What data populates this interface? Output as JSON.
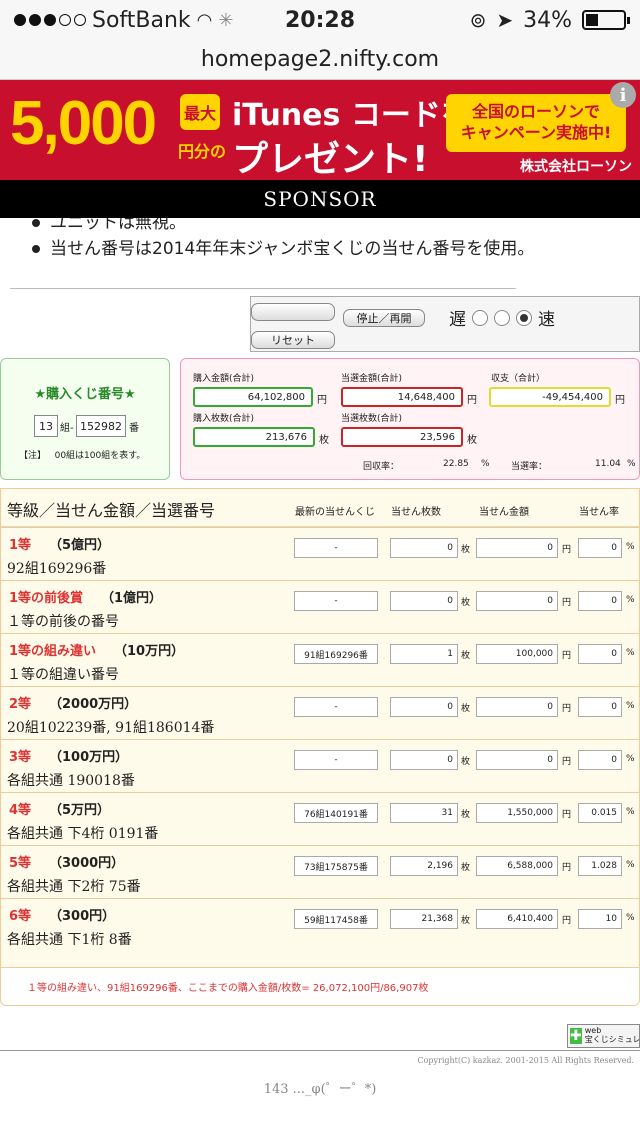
{
  "status": {
    "carrier": "SoftBank",
    "time": "20:28",
    "battery": "34%",
    "battery_level": 0.34
  },
  "url": "homepage2.nifty.com",
  "banner": {
    "amount": "5,000",
    "max": "最大",
    "yen": "円分の",
    "itunes": "iTunes コードを",
    "present": "プレゼント!",
    "box_line1": "全国のローソンで",
    "box_line2": "キャンペーン実施中!",
    "company": "株式会社ローソン",
    "info": "i"
  },
  "sponsor": "SPONSOR",
  "notes": [
    "ユニットは無視。",
    "当せん番号は2014年年末ジャンボ宝くじの当せん番号を使用。"
  ],
  "controls": {
    "stop": "停止／再開",
    "reset": "リセット",
    "slow": "遅",
    "fast": "速"
  },
  "ticket": {
    "title": "★購入くじ番号★",
    "group": "13",
    "group_unit": "組-",
    "number": "152982",
    "number_unit": "番",
    "note_label": "【注】",
    "note": "00組は100組を表す。"
  },
  "stats": {
    "purchase_amount_label": "購入金額(合計)",
    "purchase_amount": "64,102,800",
    "yen": "円",
    "win_amount_label": "当選金額(合計)",
    "win_amount": "14,648,400",
    "balance_label": "収支（合計）",
    "balance": "-49,454,400",
    "purchase_count_label": "購入枚数(合計)",
    "purchase_count": "213,676",
    "mai": "枚",
    "win_count_label": "当選枚数(合計)",
    "win_count": "23,596",
    "return_label": "回収率：",
    "return_rate": "22.85",
    "win_rate_label": "当選率：",
    "win_rate": "11.04",
    "pct": "%"
  },
  "results": {
    "headers": [
      "等級／当せん金額／当選番号",
      "最新の当せんくじ",
      "当せん枚数",
      "当せん金額",
      "当せん率"
    ],
    "units": {
      "mai": "枚",
      "yen": "円",
      "pct": "%"
    },
    "rows": [
      {
        "name": "1等",
        "amount": "（5億円）",
        "number": "92組169296番",
        "latest": "-",
        "count": "0",
        "money": "0",
        "rate": "0"
      },
      {
        "name": "1等の前後賞",
        "amount": "（1億円）",
        "number": "１等の前後の番号",
        "latest": "-",
        "count": "0",
        "money": "0",
        "rate": "0"
      },
      {
        "name": "1等の組み違い",
        "amount": "（10万円）",
        "number": "１等の組違い番号",
        "latest": "91組169296番",
        "count": "1",
        "money": "100,000",
        "rate": "0"
      },
      {
        "name": "2等",
        "amount": "（2000万円）",
        "number": "20組102239番, 91組186014番",
        "latest": "-",
        "count": "0",
        "money": "0",
        "rate": "0"
      },
      {
        "name": "3等",
        "amount": "（100万円）",
        "number": "各組共通 190018番",
        "latest": "-",
        "count": "0",
        "money": "0",
        "rate": "0"
      },
      {
        "name": "4等",
        "amount": "（5万円）",
        "number": "各組共通 下4桁 0191番",
        "latest": "76組140191番",
        "count": "31",
        "money": "1,550,000",
        "rate": "0.015"
      },
      {
        "name": "5等",
        "amount": "（3000円）",
        "number": "各組共通 下2桁 75番",
        "latest": "73組175875番",
        "count": "2,196",
        "money": "6,588,000",
        "rate": "1.028"
      },
      {
        "name": "6等",
        "amount": "（300円）",
        "number": "各組共通 下1桁 8番",
        "latest": "59組117458番",
        "count": "21,368",
        "money": "6,410,400",
        "rate": "10"
      }
    ]
  },
  "summary": "１等の組み違い、91組169296番、ここまでの購入金額/枚数= 26,072,100円/86,907枚",
  "badge": {
    "line1": "web",
    "line2": "宝くじシミュレーター"
  },
  "copyright": "Copyright(C) kazkaz. 2001-2015 All Rights Reserved.",
  "counter": "143 ..._φ(゜ー゜*)"
}
